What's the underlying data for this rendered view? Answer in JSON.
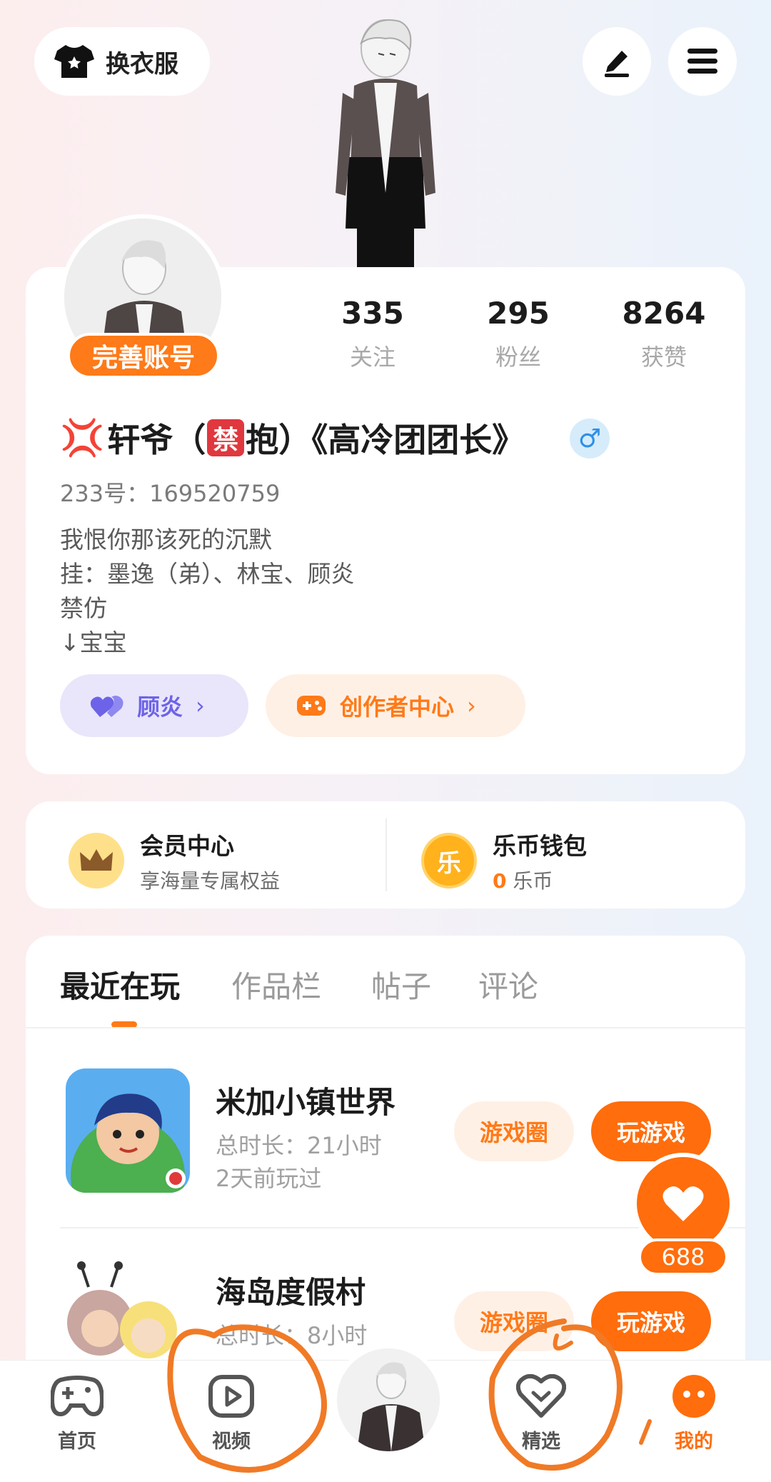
{
  "top_bar": {
    "wardrobe_label": "换衣服"
  },
  "profile": {
    "complete_account_label": "完善账号",
    "stats": [
      {
        "value": "335",
        "label": "关注"
      },
      {
        "value": "295",
        "label": "粉丝"
      },
      {
        "value": "8264",
        "label": "获赞"
      }
    ],
    "nickname_part1": "轩爷（",
    "ban_char": "禁",
    "nickname_part2": "抱）《高冷团团长》",
    "gender_symbol": "♂",
    "uid": "233号：169520759",
    "bio_lines": [
      "我恨你那该死的沉默",
      "挂：墨逸（弟）、林宝、顾炎",
      "禁仿",
      "↓宝宝"
    ],
    "pills": [
      {
        "label": "顾炎",
        "color": "#6d63e8"
      },
      {
        "label": "创作者中心",
        "color": "#ff7a18"
      }
    ]
  },
  "wallet": {
    "member": {
      "title": "会员中心",
      "subtitle": "享海量专属权益"
    },
    "coins": {
      "title": "乐币钱包",
      "amount": "0",
      "unit": " 乐币",
      "icon_char": "乐"
    }
  },
  "tabs": [
    "最近在玩",
    "作品栏",
    "帖子",
    "评论"
  ],
  "games": [
    {
      "name": "米加小镇世界",
      "duration": "总时长：21小时",
      "last_played": "2天前玩过",
      "circle_label": "游戏圈",
      "play_label": "玩游戏"
    },
    {
      "name": "海岛度假村",
      "duration": "总时长：8小时",
      "last_played": "",
      "circle_label": "游戏圈",
      "play_label": "玩游戏"
    }
  ],
  "like_count": "688",
  "bottom_nav": [
    {
      "label": "首页",
      "icon": "gamepad-icon"
    },
    {
      "label": "视频",
      "icon": "video-play-icon"
    },
    {
      "label": "精选",
      "icon": "heart-chevron-icon"
    },
    {
      "label": "我的",
      "icon": "face-icon"
    }
  ],
  "colors": {
    "accent": "#ff6d0c",
    "purple": "#6d63e8"
  }
}
